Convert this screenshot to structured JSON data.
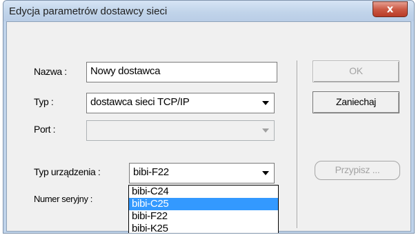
{
  "window": {
    "title": "Edycja parametrów dostawcy sieci",
    "close_label": "x"
  },
  "form": {
    "name_label": "Nazwa :",
    "name_value": "Nowy dostawca",
    "type_label": "Typ :",
    "type_value": "dostawca sieci TCP/IP",
    "port_label": "Port :",
    "port_value": "",
    "device_type_label": "Typ urządzenia :",
    "device_type_value": "bibi-F22",
    "serial_label": "Numer seryjny :"
  },
  "dropdown": {
    "items": [
      "bibi-C24",
      "bibi-C25",
      "bibi-F22",
      "bibi-K25"
    ],
    "selected": "bibi-C25"
  },
  "buttons": {
    "ok": "OK",
    "cancel": "Zaniechaj",
    "assign": "Przypisz ..."
  },
  "colors": {
    "selection": "#3399ff",
    "close_button": "#cc5a45"
  }
}
